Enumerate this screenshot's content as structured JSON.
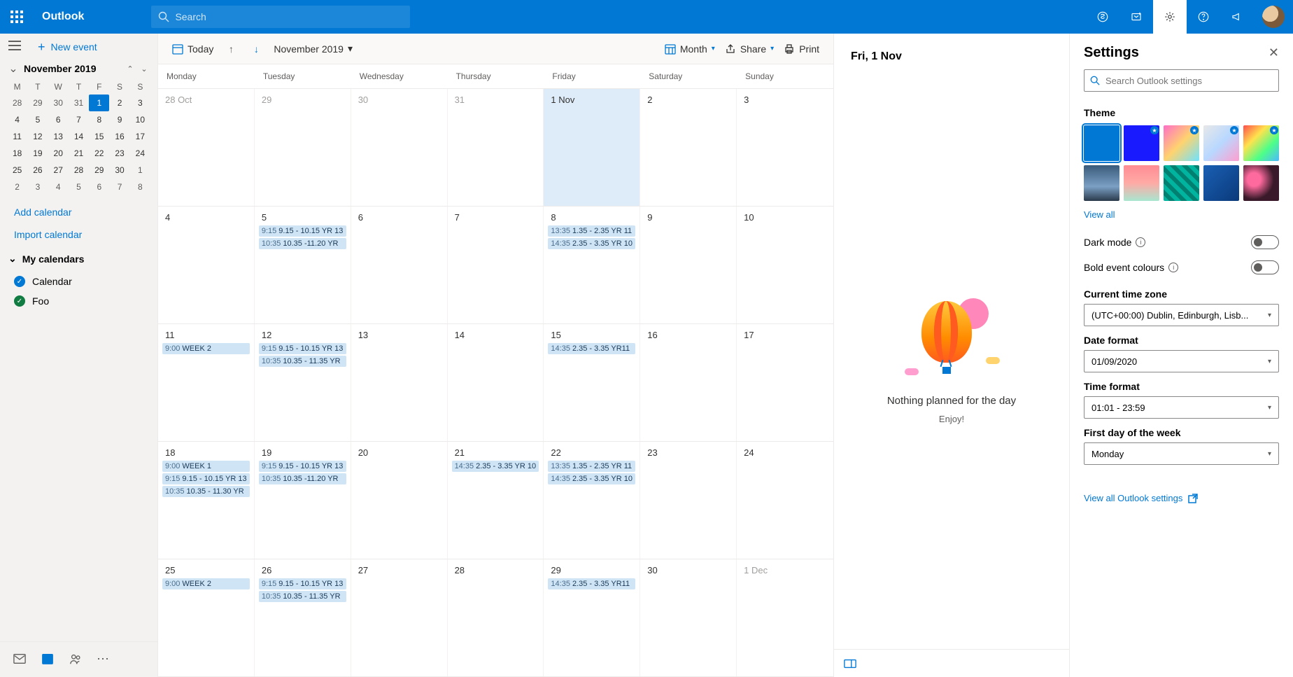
{
  "header": {
    "brand": "Outlook",
    "search_placeholder": "Search"
  },
  "sidebar": {
    "new_event": "New event",
    "mini_title": "November 2019",
    "dow": [
      "M",
      "T",
      "W",
      "T",
      "F",
      "S",
      "S"
    ],
    "mini_days": [
      {
        "n": 28,
        "in": false
      },
      {
        "n": 29,
        "in": false
      },
      {
        "n": 30,
        "in": false
      },
      {
        "n": 31,
        "in": false
      },
      {
        "n": 1,
        "in": true,
        "sel": true
      },
      {
        "n": 2,
        "in": true
      },
      {
        "n": 3,
        "in": true
      },
      {
        "n": 4,
        "in": true
      },
      {
        "n": 5,
        "in": true
      },
      {
        "n": 6,
        "in": true
      },
      {
        "n": 7,
        "in": true
      },
      {
        "n": 8,
        "in": true
      },
      {
        "n": 9,
        "in": true
      },
      {
        "n": 10,
        "in": true
      },
      {
        "n": 11,
        "in": true
      },
      {
        "n": 12,
        "in": true
      },
      {
        "n": 13,
        "in": true
      },
      {
        "n": 14,
        "in": true
      },
      {
        "n": 15,
        "in": true
      },
      {
        "n": 16,
        "in": true
      },
      {
        "n": 17,
        "in": true
      },
      {
        "n": 18,
        "in": true
      },
      {
        "n": 19,
        "in": true
      },
      {
        "n": 20,
        "in": true
      },
      {
        "n": 21,
        "in": true
      },
      {
        "n": 22,
        "in": true
      },
      {
        "n": 23,
        "in": true
      },
      {
        "n": 24,
        "in": true
      },
      {
        "n": 25,
        "in": true
      },
      {
        "n": 26,
        "in": true
      },
      {
        "n": 27,
        "in": true
      },
      {
        "n": 28,
        "in": true
      },
      {
        "n": 29,
        "in": true
      },
      {
        "n": 30,
        "in": true
      },
      {
        "n": 1,
        "in": false
      },
      {
        "n": 2,
        "in": false
      },
      {
        "n": 3,
        "in": false
      },
      {
        "n": 4,
        "in": false
      },
      {
        "n": 5,
        "in": false
      },
      {
        "n": 6,
        "in": false
      },
      {
        "n": 7,
        "in": false
      },
      {
        "n": 8,
        "in": false
      }
    ],
    "add_calendar": "Add calendar",
    "import_calendar": "Import calendar",
    "my_calendars": "My calendars",
    "calendars": [
      {
        "name": "Calendar",
        "color": "blue"
      },
      {
        "name": "Foo",
        "color": "green"
      }
    ]
  },
  "toolbar": {
    "today": "Today",
    "month_label": "November 2019",
    "view": "Month",
    "share": "Share",
    "print": "Print"
  },
  "cal": {
    "dow": [
      "Monday",
      "Tuesday",
      "Wednesday",
      "Thursday",
      "Friday",
      "Saturday",
      "Sunday"
    ],
    "weeks": [
      [
        {
          "label": "28 Oct",
          "out": true
        },
        {
          "label": "29",
          "out": true
        },
        {
          "label": "30",
          "out": true
        },
        {
          "label": "31",
          "out": true
        },
        {
          "label": "1 Nov",
          "today": true
        },
        {
          "label": "2"
        },
        {
          "label": "3"
        }
      ],
      [
        {
          "label": "4"
        },
        {
          "label": "5",
          "events": [
            {
              "t": "9:15",
              "s": "9.15 - 10.15 YR 13"
            },
            {
              "t": "10:35",
              "s": "10.35 -11.20 YR"
            }
          ]
        },
        {
          "label": "6"
        },
        {
          "label": "7"
        },
        {
          "label": "8",
          "events": [
            {
              "t": "13:35",
              "s": "1.35 - 2.35 YR 11"
            },
            {
              "t": "14:35",
              "s": "2.35 - 3.35 YR 10"
            }
          ]
        },
        {
          "label": "9"
        },
        {
          "label": "10"
        }
      ],
      [
        {
          "label": "11",
          "events": [
            {
              "t": "9:00",
              "s": "WEEK 2"
            }
          ]
        },
        {
          "label": "12",
          "events": [
            {
              "t": "9:15",
              "s": "9.15 - 10.15 YR 13"
            },
            {
              "t": "10:35",
              "s": "10.35 - 11.35 YR"
            }
          ]
        },
        {
          "label": "13"
        },
        {
          "label": "14"
        },
        {
          "label": "15",
          "events": [
            {
              "t": "14:35",
              "s": "2.35 - 3.35 YR11"
            }
          ]
        },
        {
          "label": "16"
        },
        {
          "label": "17"
        }
      ],
      [
        {
          "label": "18",
          "events": [
            {
              "t": "9:00",
              "s": "WEEK 1"
            },
            {
              "t": "9:15",
              "s": "9.15 - 10.15 YR 13"
            },
            {
              "t": "10:35",
              "s": "10.35 - 11.30 YR"
            }
          ]
        },
        {
          "label": "19",
          "events": [
            {
              "t": "9:15",
              "s": "9.15 - 10.15 YR 13"
            },
            {
              "t": "10:35",
              "s": "10.35 -11.20 YR"
            }
          ]
        },
        {
          "label": "20"
        },
        {
          "label": "21",
          "events": [
            {
              "t": "14:35",
              "s": "2.35 - 3.35 YR 10"
            }
          ]
        },
        {
          "label": "22",
          "events": [
            {
              "t": "13:35",
              "s": "1.35 - 2.35 YR 11"
            },
            {
              "t": "14:35",
              "s": "2.35 - 3.35 YR 10"
            }
          ]
        },
        {
          "label": "23"
        },
        {
          "label": "24"
        }
      ],
      [
        {
          "label": "25",
          "events": [
            {
              "t": "9:00",
              "s": "WEEK 2"
            }
          ]
        },
        {
          "label": "26",
          "events": [
            {
              "t": "9:15",
              "s": "9.15 - 10.15 YR 13"
            },
            {
              "t": "10:35",
              "s": "10.35 - 11.35 YR"
            }
          ]
        },
        {
          "label": "27"
        },
        {
          "label": "28"
        },
        {
          "label": "29",
          "events": [
            {
              "t": "14:35",
              "s": "2.35 - 3.35 YR11"
            }
          ]
        },
        {
          "label": "30"
        },
        {
          "label": "1 Dec",
          "out": true
        }
      ]
    ]
  },
  "agenda": {
    "date": "Fri, 1 Nov",
    "empty_head": "Nothing planned for the day",
    "empty_sub": "Enjoy!"
  },
  "settings": {
    "title": "Settings",
    "search_placeholder": "Search Outlook settings",
    "theme_label": "Theme",
    "view_all": "View all",
    "dark_mode": "Dark mode",
    "bold_colours": "Bold event colours",
    "timezone_label": "Current time zone",
    "timezone_value": "(UTC+00:00) Dublin, Edinburgh, Lisb...",
    "date_format_label": "Date format",
    "date_format_value": "01/09/2020",
    "time_format_label": "Time format",
    "time_format_value": "01:01 - 23:59",
    "first_day_label": "First day of the week",
    "first_day_value": "Monday",
    "view_all_outlook": "View all Outlook settings"
  },
  "themes": [
    {
      "bg": "#0078d4",
      "sel": true
    },
    {
      "bg": "#1a1aff",
      "star": true
    },
    {
      "bg": "linear-gradient(135deg,#ff6ec7,#ffd36e,#6ee2ff)",
      "star": true
    },
    {
      "bg": "linear-gradient(135deg,#e8e8e8,#b8d8ff,#ff9ecf)",
      "star": true
    },
    {
      "bg": "linear-gradient(135deg,#ff4d4d,#ffe24d,#4dff88,#4db8ff)",
      "star": true
    },
    {
      "bg": "linear-gradient(180deg,#3a5a7a 0%,#7aa0c4 60%,#2a3a4a 100%)"
    },
    {
      "bg": "linear-gradient(180deg,#ff8c94 0%,#ffaaa5 50%,#a8e6cf 100%)"
    },
    {
      "bg": "repeating-linear-gradient(45deg,#00b4a0 0 6px,#008070 6px 12px)"
    },
    {
      "bg": "linear-gradient(135deg,#1a5fb4,#0a3a7a)"
    },
    {
      "bg": "radial-gradient(circle at 30% 40%,#ff6a9e 0 20%,#3a1a2a 60%)"
    }
  ]
}
